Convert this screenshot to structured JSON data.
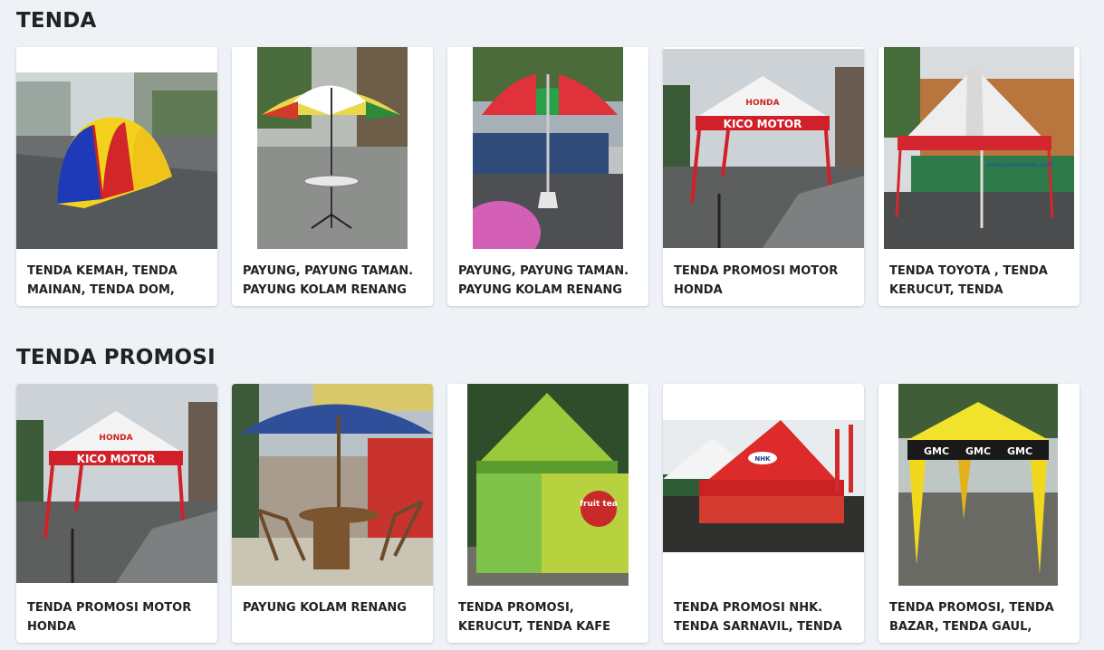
{
  "sections": [
    {
      "title": "TENDA",
      "cards": [
        {
          "caption": "TENDA KEMAH, TENDA MAINAN, TENDA DOM,"
        },
        {
          "caption": "PAYUNG, PAYUNG TAMAN. PAYUNG KOLAM RENANG"
        },
        {
          "caption": "PAYUNG, PAYUNG TAMAN. PAYUNG KOLAM RENANG"
        },
        {
          "caption": "TENDA PROMOSI MOTOR HONDA"
        },
        {
          "caption": "TENDA TOYOTA , TENDA KERUCUT, TENDA PROMOSI."
        }
      ]
    },
    {
      "title": "TENDA PROMOSI",
      "cards": [
        {
          "caption": "TENDA PROMOSI MOTOR HONDA"
        },
        {
          "caption": "PAYUNG KOLAM RENANG"
        },
        {
          "caption": "TENDA PROMOSI, KERUCUT, TENDA KAFE"
        },
        {
          "caption": "TENDA PROMOSI NHK. TENDA SARNAVIL, TENDA"
        },
        {
          "caption": "TENDA PROMOSI, TENDA BAZAR, TENDA GAUL, TENDA"
        }
      ]
    }
  ],
  "photo_text": {
    "honda": "HONDA",
    "kico": "KICO MOTOR",
    "toyota_sign": "www.sewatenda.com",
    "fruit_tea": "fruit tea",
    "nhk": "NHK",
    "gmc": "GMC"
  }
}
